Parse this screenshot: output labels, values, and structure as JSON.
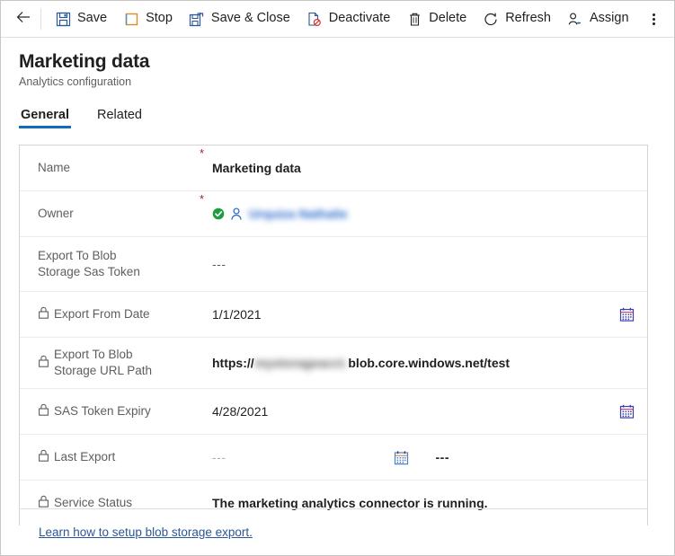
{
  "commandbar": {
    "back_icon": "arrow-left-icon",
    "more_icon": "overflow-menu-icon",
    "buttons": [
      {
        "label": "Save",
        "icon": "save-icon"
      },
      {
        "label": "Stop",
        "icon": "stop-square-icon"
      },
      {
        "label": "Save & Close",
        "icon": "save-and-close-icon"
      },
      {
        "label": "Deactivate",
        "icon": "deactivate-document-icon"
      },
      {
        "label": "Delete",
        "icon": "trash-icon"
      },
      {
        "label": "Refresh",
        "icon": "refresh-icon"
      },
      {
        "label": "Assign",
        "icon": "assign-person-icon"
      }
    ]
  },
  "header": {
    "title": "Marketing data",
    "subtitle": "Analytics configuration"
  },
  "tabs": [
    {
      "label": "General",
      "active": true
    },
    {
      "label": "Related",
      "active": false
    }
  ],
  "form": {
    "rows": [
      {
        "label": "Name",
        "required": "*",
        "locked": false,
        "value": "Marketing data"
      },
      {
        "label": "Owner",
        "required": "*",
        "locked": false,
        "value": "",
        "owner_name_redacted": "Urquiza Nathalie",
        "valid_icon": "check-circle-icon",
        "person_icon": "person-icon"
      },
      {
        "label": "Export To Blob Storage Sas Token",
        "required": "",
        "locked": false,
        "value": "---"
      },
      {
        "label": "Export From Date",
        "required": "",
        "locked": true,
        "value": "1/1/2021",
        "calendar_icon": "calendar-icon"
      },
      {
        "label": "Export To Blob Storage URL Path",
        "required": "",
        "locked": true,
        "url_prefix": "https://",
        "url_redacted": "mystorageacct.",
        "url_suffix": "blob.core.windows.net/test"
      },
      {
        "label": "SAS Token Expiry",
        "required": "",
        "locked": true,
        "value": "4/28/2021",
        "calendar_icon": "calendar-icon"
      },
      {
        "label": "Last Export",
        "required": "",
        "locked": true,
        "value": "---",
        "value2": "---",
        "calendar_icon": "calendar-icon"
      },
      {
        "label": "Service Status",
        "required": "",
        "locked": true,
        "value": "The marketing analytics connector is running."
      }
    ]
  },
  "footer": {
    "link_label": "Learn how to setup blob storage export."
  },
  "colors": {
    "accent": "#0f6cbd",
    "link": "#2b5797",
    "required": "#a4262c",
    "valid": "#1a9e3e",
    "icon_blue": "#2b579a",
    "stop_orange": "#d98d28",
    "delete_red": "#d13438",
    "border": "#d6d4d2",
    "row_divider": "#edebe9"
  }
}
